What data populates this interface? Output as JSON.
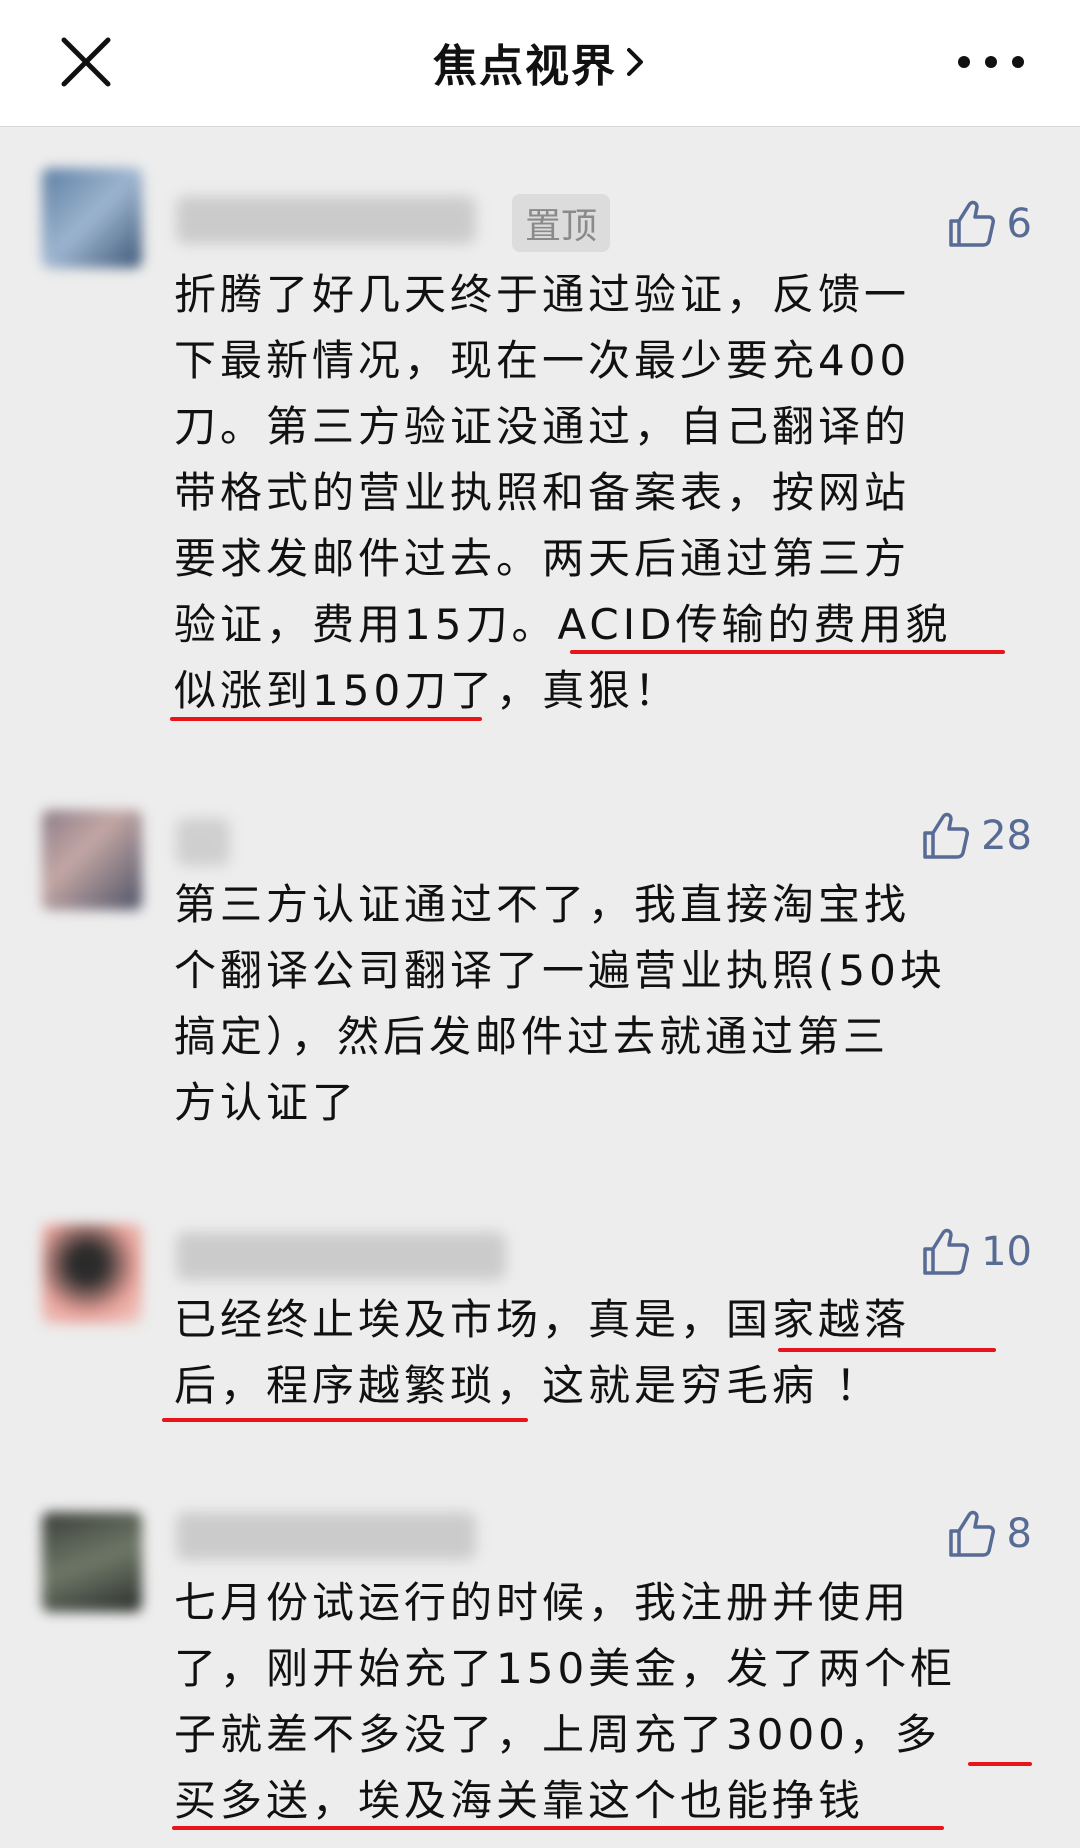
{
  "header": {
    "title": "焦点视界",
    "close_icon": "close-icon",
    "more_icon": "more-icon"
  },
  "colors": {
    "background": "#ededed",
    "link_blue": "#576b95",
    "underline_red": "#e8131b"
  },
  "comments": [
    {
      "pinned_label": "置顶",
      "likes": "6",
      "lines": [
        "折腾了好几天终于通过验证，反馈一",
        "下最新情况，现在一次最少要充400",
        "刀。第三方验证没通过，自己翻译的",
        "带格式的营业执照和备案表，按网站",
        "要求发邮件过去。两天后通过第三方",
        "验证，费用15刀。ACID传输的费用貌",
        "似涨到150刀了，真狠！"
      ]
    },
    {
      "likes": "28",
      "lines": [
        "第三方认证通过不了，我直接淘宝找",
        "个翻译公司翻译了一遍营业执照(50块",
        "搞定），然后发邮件过去就通过第三",
        "方认证了"
      ]
    },
    {
      "likes": "10",
      "lines": [
        "已经终止埃及市场，真是，国家越落",
        "后，程序越繁琐，这就是穷毛病 ！"
      ]
    },
    {
      "likes": "8",
      "lines": [
        "七月份试运行的时候，我注册并使用",
        "了，刚开始充了150美金，发了两个柜",
        "子就差不多没了，上周充了3000，多",
        "买多送，埃及海关靠这个也能挣钱"
      ]
    }
  ]
}
